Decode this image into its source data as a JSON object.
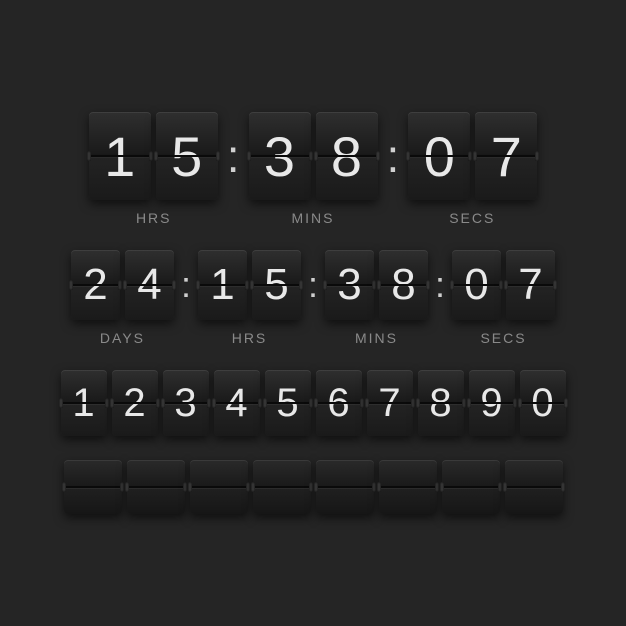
{
  "countdown_hms": {
    "hours": [
      "1",
      "5"
    ],
    "minutes": [
      "3",
      "8"
    ],
    "seconds": [
      "0",
      "7"
    ],
    "labels": {
      "hours": "HRS",
      "minutes": "MINS",
      "seconds": "SECS"
    }
  },
  "countdown_dhms": {
    "days": [
      "2",
      "4"
    ],
    "hours": [
      "1",
      "5"
    ],
    "minutes": [
      "3",
      "8"
    ],
    "seconds": [
      "0",
      "7"
    ],
    "labels": {
      "days": "DAYS",
      "hours": "HRS",
      "minutes": "MINS",
      "seconds": "SECS"
    }
  },
  "digits_strip": [
    "1",
    "2",
    "3",
    "4",
    "5",
    "6",
    "7",
    "8",
    "9",
    "0"
  ],
  "blank_cards_count": 8,
  "colors": {
    "background": "#252525",
    "digit": "#e8e8e8",
    "label": "#8a8a8a"
  }
}
